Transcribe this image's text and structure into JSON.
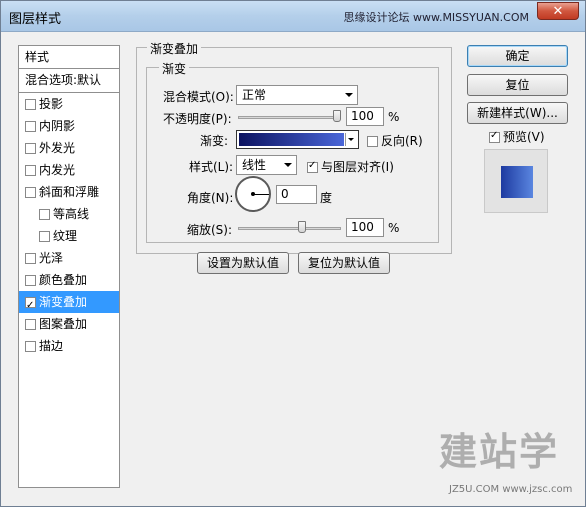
{
  "window": {
    "title": "图层样式",
    "brand": "思缘设计论坛 www.MISSYUAN.COM",
    "close": "✕"
  },
  "styles_panel": {
    "header": "样式",
    "blend_options": "混合选项:默认",
    "items": [
      {
        "label": "投影",
        "checked": false,
        "sub": false,
        "selected": false
      },
      {
        "label": "内阴影",
        "checked": false,
        "sub": false,
        "selected": false
      },
      {
        "label": "外发光",
        "checked": false,
        "sub": false,
        "selected": false
      },
      {
        "label": "内发光",
        "checked": false,
        "sub": false,
        "selected": false
      },
      {
        "label": "斜面和浮雕",
        "checked": false,
        "sub": false,
        "selected": false
      },
      {
        "label": "等高线",
        "checked": false,
        "sub": true,
        "selected": false
      },
      {
        "label": "纹理",
        "checked": false,
        "sub": true,
        "selected": false
      },
      {
        "label": "光泽",
        "checked": false,
        "sub": false,
        "selected": false
      },
      {
        "label": "颜色叠加",
        "checked": false,
        "sub": false,
        "selected": false
      },
      {
        "label": "渐变叠加",
        "checked": true,
        "sub": false,
        "selected": true
      },
      {
        "label": "图案叠加",
        "checked": false,
        "sub": false,
        "selected": false
      },
      {
        "label": "描边",
        "checked": false,
        "sub": false,
        "selected": false
      }
    ]
  },
  "gradient_overlay": {
    "section_title": "渐变叠加",
    "subsection_title": "渐变",
    "blend_mode_label": "混合模式(O):",
    "blend_mode_value": "正常",
    "opacity_label": "不透明度(P):",
    "opacity_value": "100",
    "opacity_unit": "%",
    "opacity_fraction": 1.0,
    "gradient_label": "渐变:",
    "reverse_label": "反向(R)",
    "reverse_checked": false,
    "style_label": "样式(L):",
    "style_value": "线性",
    "align_label": "与图层对齐(I)",
    "align_checked": true,
    "angle_label": "角度(N):",
    "angle_value": "0",
    "angle_unit": "度",
    "scale_label": "缩放(S):",
    "scale_value": "100",
    "scale_unit": "%",
    "scale_fraction": 0.5,
    "make_default": "设置为默认值",
    "reset_default": "复位为默认值",
    "colors": {
      "gradient_start": "#0c1360",
      "gradient_end": "#4a66d8"
    }
  },
  "buttons": {
    "ok": "确定",
    "reset": "复位",
    "new_style": "新建样式(W)...",
    "preview_label": "预览(V)",
    "preview_checked": true
  },
  "watermark": {
    "text": "建站学",
    "url": "JZ5U.COM  www.jzsc.com"
  }
}
